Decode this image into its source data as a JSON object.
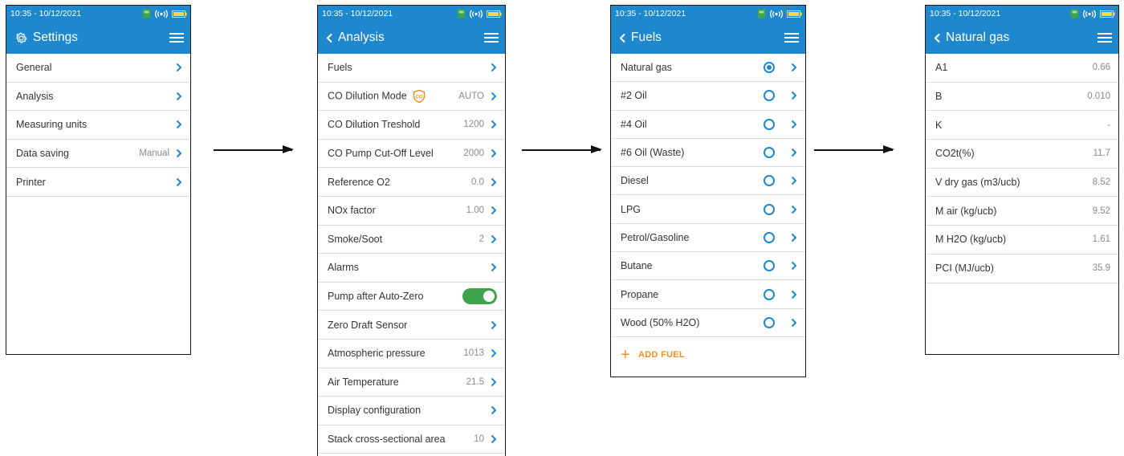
{
  "colors": {
    "header": "#1e88cf",
    "accent": "#1e88cf",
    "toggle_on": "#3fa34d",
    "add_action": "#f0901e"
  },
  "status": {
    "time": "10:35 - 10/12/2021",
    "icons": [
      "device-connected-icon",
      "wireless-signal-icon",
      "battery-icon"
    ]
  },
  "settings": {
    "title": "Settings",
    "rows": [
      {
        "label": "General",
        "value": ""
      },
      {
        "label": "Analysis",
        "value": ""
      },
      {
        "label": "Measuring units",
        "value": ""
      },
      {
        "label": "Data saving",
        "value": "Manual"
      },
      {
        "label": "Printer",
        "value": ""
      }
    ]
  },
  "analysis": {
    "title": "Analysis",
    "rows": [
      {
        "label": "Fuels",
        "value": ""
      },
      {
        "label": "CO Dilution Mode",
        "value": "AUTO",
        "badge": "CO"
      },
      {
        "label": "CO Dilution Treshold",
        "value": "1200"
      },
      {
        "label": "CO Pump Cut-Off Level",
        "value": "2000"
      },
      {
        "label": "Reference O2",
        "value": "0.0"
      },
      {
        "label": "NOx factor",
        "value": "1.00"
      },
      {
        "label": "Smoke/Soot",
        "value": "2"
      },
      {
        "label": "Alarms",
        "value": ""
      },
      {
        "label": "Pump after Auto-Zero",
        "value": "",
        "toggle": true
      },
      {
        "label": "Zero Draft Sensor",
        "value": ""
      },
      {
        "label": "Atmospheric pressure",
        "value": "1013"
      },
      {
        "label": "Air Temperature",
        "value": "21.5"
      },
      {
        "label": "Display configuration",
        "value": ""
      },
      {
        "label": "Stack cross-sectional area",
        "value": "10"
      }
    ]
  },
  "fuels": {
    "title": "Fuels",
    "rows": [
      {
        "label": "Natural gas",
        "selected": true
      },
      {
        "label": "#2 Oil",
        "selected": false
      },
      {
        "label": "#4 Oil",
        "selected": false
      },
      {
        "label": "#6 Oil (Waste)",
        "selected": false
      },
      {
        "label": "Diesel",
        "selected": false
      },
      {
        "label": "LPG",
        "selected": false
      },
      {
        "label": "Petrol/Gasoline",
        "selected": false
      },
      {
        "label": "Butane",
        "selected": false
      },
      {
        "label": "Propane",
        "selected": false
      },
      {
        "label": "Wood (50% H2O)",
        "selected": false
      }
    ],
    "add_label": "ADD FUEL"
  },
  "natural_gas": {
    "title": "Natural gas",
    "rows": [
      {
        "label": "A1",
        "value": "0.66"
      },
      {
        "label": "B",
        "value": "0.010"
      },
      {
        "label": "K",
        "value": "-"
      },
      {
        "label": "CO2t(%)",
        "value": "11.7"
      },
      {
        "label": "V dry gas (m3/ucb)",
        "value": "8.52"
      },
      {
        "label": "M air (kg/ucb)",
        "value": "9.52"
      },
      {
        "label": "M H2O (kg/ucb)",
        "value": "1.61"
      },
      {
        "label": "PCI (MJ/ucb)",
        "value": "35.9"
      }
    ]
  }
}
